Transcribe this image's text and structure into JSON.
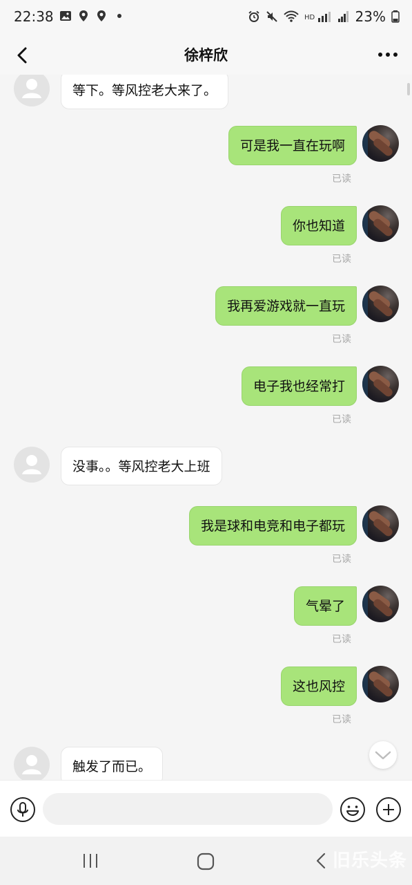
{
  "status_bar": {
    "time": "22:38",
    "battery": "23%",
    "icons": [
      "image-icon",
      "location-icon",
      "location-icon",
      "dot-icon",
      "alarm-icon",
      "mute-icon",
      "wifi-icon",
      "hd-signal-icon",
      "signal-icon",
      "battery-icon"
    ]
  },
  "header": {
    "title": "徐梓欣",
    "back_icon": "chevron-left-icon",
    "more_icon": "more-dots-icon"
  },
  "messages": [
    {
      "side": "in",
      "text": "等下。等风控老大来了。"
    },
    {
      "side": "out",
      "text": "可是我一直在玩啊",
      "status": "已读"
    },
    {
      "side": "out",
      "text": "你也知道",
      "status": "已读"
    },
    {
      "side": "out",
      "text": "我再爱游戏就一直玩",
      "status": "已读"
    },
    {
      "side": "out",
      "text": "电子我也经常打",
      "status": "已读"
    },
    {
      "side": "in",
      "text": "没事。。等风控老大上班"
    },
    {
      "side": "out",
      "text": "我是球和电竞和电子都玩",
      "status": "已读"
    },
    {
      "side": "out",
      "text": "气晕了",
      "status": "已读"
    },
    {
      "side": "out",
      "text": "这也风控",
      "status": "已读"
    },
    {
      "side": "in",
      "text": "触发了而已。"
    }
  ],
  "input_bar": {
    "placeholder": "",
    "voice_icon": "microphone-icon",
    "emoji_icon": "emoji-icon",
    "add_icon": "plus-icon"
  },
  "watermark": "旧乐头条",
  "colors": {
    "outgoing_bubble": "#a8e47a",
    "incoming_bubble": "#ffffff",
    "background": "#f5f5f5"
  }
}
